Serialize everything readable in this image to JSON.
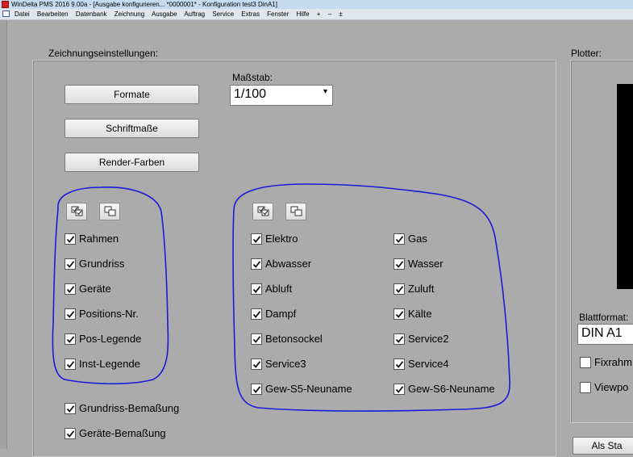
{
  "window": {
    "title": "WinDelta PMS 2016 9.00a - [Ausgabe konfigurieren... *0000001* - Konfiguration test3 DinA1]"
  },
  "menu": {
    "items": [
      "Datei",
      "Bearbeiten",
      "Datenbank",
      "Zeichnung",
      "Ausgabe",
      "Auftrag",
      "Service",
      "Extras",
      "Fenster",
      "Hilfe",
      "+",
      "–",
      "±"
    ]
  },
  "zeichnung": {
    "group_label": "Zeichnungseinstellungen:",
    "massstab_label": "Maßstab:",
    "massstab_value": "1/100",
    "buttons": {
      "formate": "Formate",
      "schriftmasse": "Schriftmaße",
      "render_farben": "Render-Farben"
    },
    "left_checks": [
      {
        "label": "Rahmen",
        "checked": true
      },
      {
        "label": "Grundriss",
        "checked": true
      },
      {
        "label": "Geräte",
        "checked": true
      },
      {
        "label": "Positions-Nr.",
        "checked": true
      },
      {
        "label": "Pos-Legende",
        "checked": true
      },
      {
        "label": "Inst-Legende",
        "checked": true
      }
    ],
    "mid_checks_col1": [
      {
        "label": "Elektro",
        "checked": true
      },
      {
        "label": "Abwasser",
        "checked": true
      },
      {
        "label": "Abluft",
        "checked": true
      },
      {
        "label": "Dampf",
        "checked": true
      },
      {
        "label": "Betonsockel",
        "checked": true
      },
      {
        "label": "Service3",
        "checked": true
      },
      {
        "label": "Gew-S5-Neuname",
        "checked": true
      }
    ],
    "mid_checks_col2": [
      {
        "label": "Gas",
        "checked": true
      },
      {
        "label": "Wasser",
        "checked": true
      },
      {
        "label": "Zuluft",
        "checked": true
      },
      {
        "label": "Kälte",
        "checked": true
      },
      {
        "label": "Service2",
        "checked": true
      },
      {
        "label": "Service4",
        "checked": true
      },
      {
        "label": "Gew-S6-Neuname",
        "checked": true
      }
    ],
    "bottom_checks": [
      {
        "label": "Grundriss-Bemaßung",
        "checked": true
      },
      {
        "label": "Geräte-Bemaßung",
        "checked": true
      }
    ]
  },
  "plotter": {
    "group_label": "Plotter:",
    "blattformat_label": "Blattformat:",
    "blattformat_value": "DIN A1",
    "checks": [
      {
        "label": "Fixrahm",
        "checked": false
      },
      {
        "label": "Viewpo",
        "checked": false
      }
    ],
    "button_label": "Als Sta"
  },
  "annotation_color": "#1a1ad8"
}
